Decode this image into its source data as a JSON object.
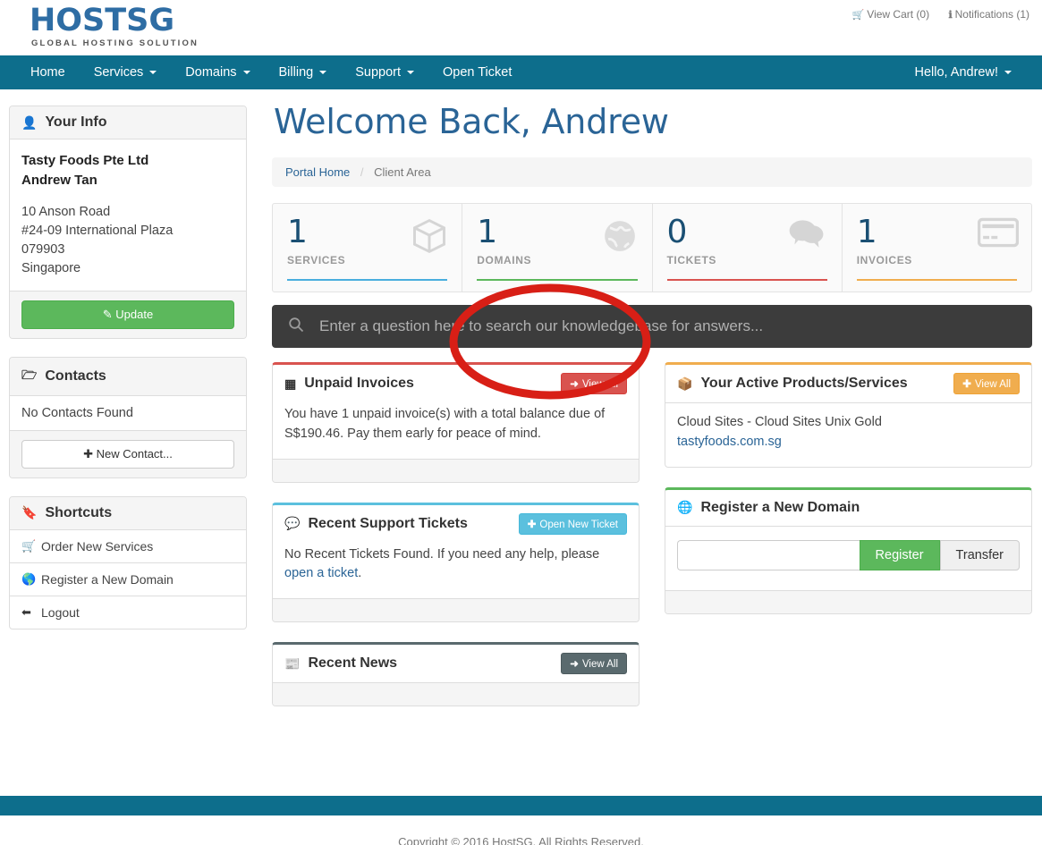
{
  "brand": {
    "logo_main": "HOSTSG",
    "logo_sub": "GLOBAL HOSTING SOLUTION",
    "accent_teal": "#0d6e8c",
    "link_blue": "#2a6496"
  },
  "utility": {
    "cart_label": "View Cart (0)",
    "cart_icon": "cart-icon",
    "notifications_label": "Notifications (1)",
    "notifications_icon": "info-icon"
  },
  "nav": {
    "items": [
      {
        "label": "Home",
        "caret": false
      },
      {
        "label": "Services",
        "caret": true
      },
      {
        "label": "Domains",
        "caret": true
      },
      {
        "label": "Billing",
        "caret": true
      },
      {
        "label": "Support",
        "caret": true
      },
      {
        "label": "Open Ticket",
        "caret": false
      }
    ],
    "account_label": "Hello, Andrew!"
  },
  "sidebar": {
    "your_info": {
      "title": "Your Info",
      "icon": "user-icon",
      "company": "Tasty Foods Pte Ltd",
      "person": "Andrew Tan",
      "address_lines": [
        "10 Anson Road",
        "#24-09 International Plaza",
        "079903",
        "Singapore"
      ],
      "update_label": "Update",
      "update_icon": "pencil-icon"
    },
    "contacts": {
      "title": "Contacts",
      "icon": "folder-icon",
      "empty_text": "No Contacts Found",
      "new_contact_label": "New Contact...",
      "new_contact_icon": "plus-icon"
    },
    "shortcuts": {
      "title": "Shortcuts",
      "icon": "bookmark-icon",
      "items": [
        {
          "label": "Order New Services",
          "icon": "cart-icon"
        },
        {
          "label": "Register a New Domain",
          "icon": "globe-icon"
        },
        {
          "label": "Logout",
          "icon": "arrow-left-icon"
        }
      ]
    }
  },
  "main": {
    "page_title": "Welcome Back, Andrew",
    "breadcrumb": {
      "home": "Portal Home",
      "separator": "/",
      "current": "Client Area"
    },
    "stats": [
      {
        "value": "1",
        "label": "SERVICES",
        "bar_color": "#4aaede",
        "icon": "box-icon"
      },
      {
        "value": "1",
        "label": "DOMAINS",
        "bar_color": "#5cb85c",
        "icon": "globe-icon"
      },
      {
        "value": "0",
        "label": "TICKETS",
        "bar_color": "#d9534f",
        "icon": "comments-icon"
      },
      {
        "value": "1",
        "label": "INVOICES",
        "bar_color": "#f0ad4e",
        "icon": "credit-card-icon"
      }
    ],
    "kb_search": {
      "placeholder": "Enter a question here to search our knowledgebase for answers...",
      "icon": "search-icon",
      "value": ""
    },
    "cards": {
      "unpaid_invoices": {
        "title": "Unpaid Invoices",
        "icon": "table-icon",
        "accent": "#d9534f",
        "button_label": "View All",
        "button_icon": "arrow-right-icon",
        "body": "You have 1 unpaid invoice(s) with a total balance due of S$190.46. Pay them early for peace of mind."
      },
      "recent_tickets": {
        "title": "Recent Support Tickets",
        "icon": "comments-icon",
        "accent": "#5bc0de",
        "button_label": "Open New Ticket",
        "button_icon": "plus-icon",
        "body_text": "No Recent Tickets Found. If you need any help, please ",
        "body_link": "open a ticket",
        "body_tail": "."
      },
      "recent_news": {
        "title": "Recent News",
        "icon": "newspaper-icon",
        "accent": "#5a6a6e",
        "button_label": "View All",
        "button_icon": "arrow-right-icon"
      },
      "active_products": {
        "title": "Your Active Products/Services",
        "icon": "box-icon",
        "accent": "#f0ad4e",
        "button_label": "View All",
        "button_icon": "plus-icon",
        "product": "Cloud Sites - Cloud Sites Unix Gold",
        "domain_link": "tastyfoods.com.sg"
      },
      "register_domain": {
        "title": "Register a New Domain",
        "icon": "globe-icon",
        "accent": "#5cb85c",
        "input_value": "",
        "register_label": "Register",
        "transfer_label": "Transfer"
      }
    }
  },
  "annotation": {
    "shape": "ellipse",
    "color": "#d81f16",
    "target": "DOMAINS"
  },
  "footer": {
    "copyright": "Copyright © 2016 HostSG. All Rights Reserved."
  }
}
